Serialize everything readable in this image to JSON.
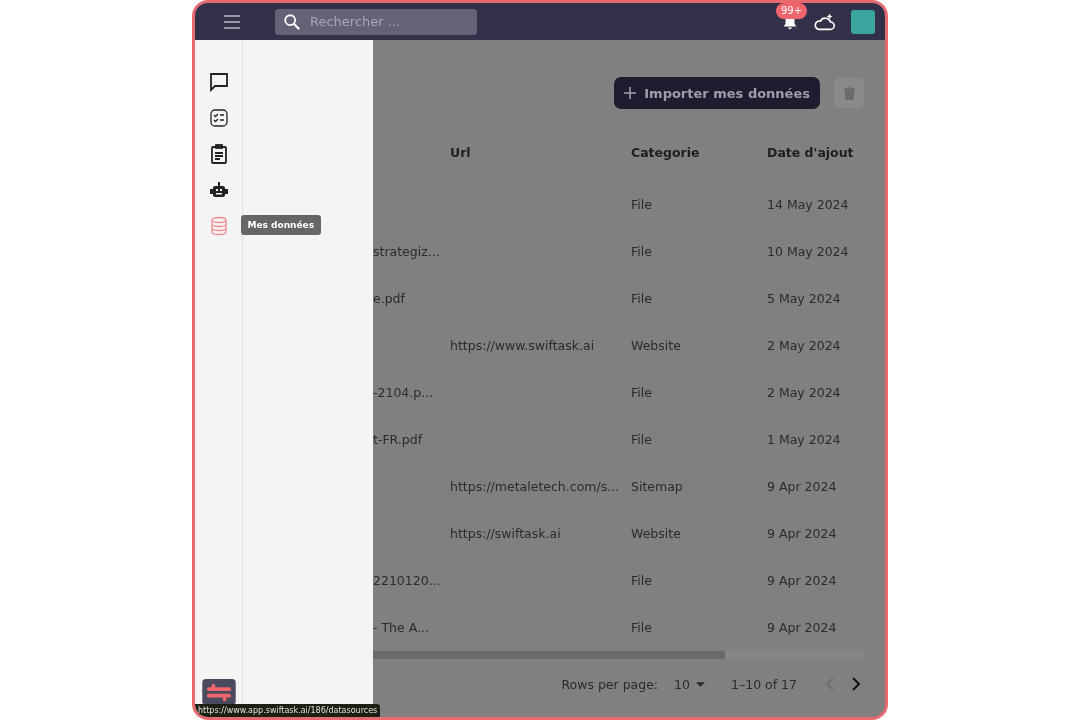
{
  "topbar": {
    "search": {
      "placeholder": "Rechercher ..."
    },
    "notification_badge": "99+"
  },
  "rail": {
    "items": [
      {
        "kind": "chat",
        "selected": false
      },
      {
        "kind": "checklist",
        "selected": false
      },
      {
        "kind": "clipboard",
        "selected": false
      },
      {
        "kind": "robot",
        "selected": false
      },
      {
        "kind": "database",
        "selected": true,
        "tooltip": "Mes données"
      }
    ]
  },
  "toolbar": {
    "import_button": "Importer mes données"
  },
  "table": {
    "columns": [
      "Url",
      "Categorie",
      "Date d'ajout"
    ],
    "rows": [
      {
        "name": "",
        "url": "",
        "category": "File",
        "date": "14 May 2024"
      },
      {
        "name": "strategiz...",
        "url": "",
        "category": "File",
        "date": "10 May 2024"
      },
      {
        "name": "e.pdf",
        "url": "",
        "category": "File",
        "date": "5 May 2024"
      },
      {
        "name": "",
        "url": "https://www.swiftask.ai",
        "category": "Website",
        "date": "2 May 2024"
      },
      {
        "name": "-2104.p...",
        "url": "",
        "category": "File",
        "date": "2 May 2024"
      },
      {
        "name": "t-FR.pdf",
        "url": "",
        "category": "File",
        "date": "1 May 2024"
      },
      {
        "name": "",
        "url": "https://metaletech.com/s...",
        "category": "Sitemap",
        "date": "9 Apr 2024"
      },
      {
        "name": "",
        "url": "https://swiftask.ai",
        "category": "Website",
        "date": "9 Apr 2024"
      },
      {
        "name": "2210120...",
        "url": "",
        "category": "File",
        "date": "9 Apr 2024"
      },
      {
        "name": "- The A...",
        "url": "",
        "category": "File",
        "date": "9 Apr 2024"
      }
    ]
  },
  "pagination": {
    "rows_per_page_label": "Rows per page:",
    "rows_per_page": "10",
    "range": "1–10 of 17"
  },
  "status_url": "https://www.app.swiftask.ai/186/datasources"
}
